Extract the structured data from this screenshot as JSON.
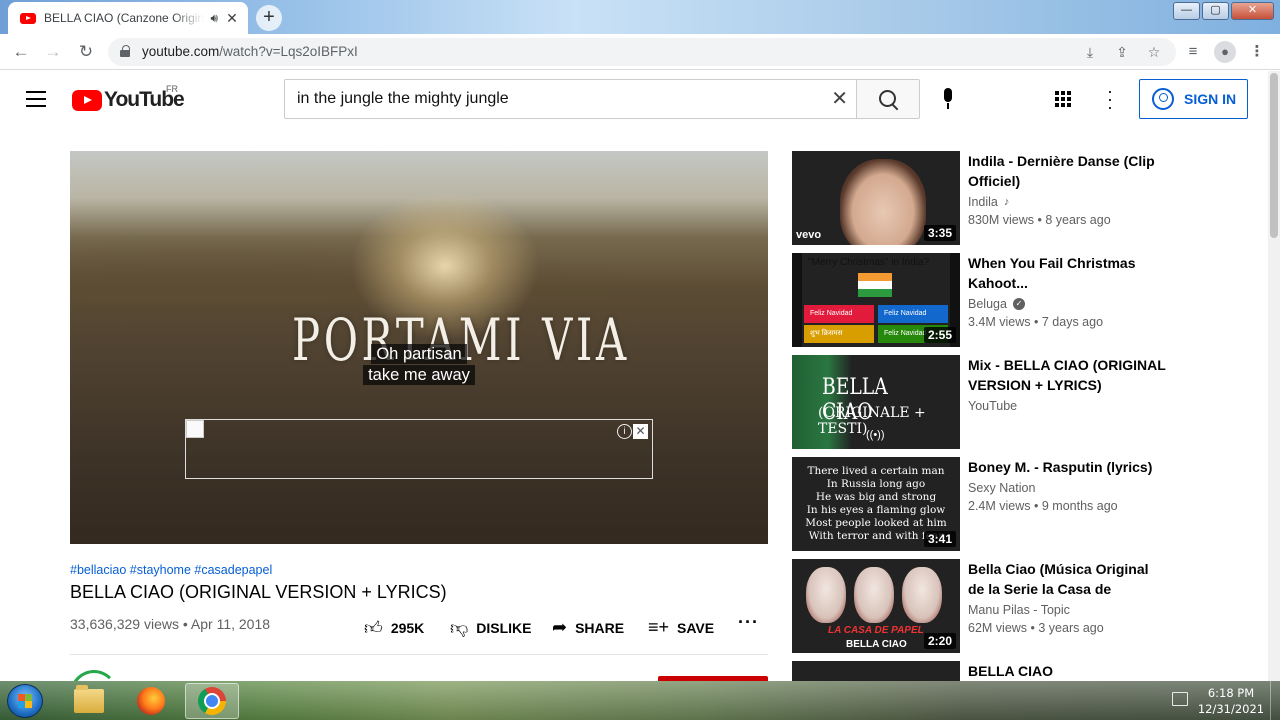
{
  "browser": {
    "tab_title": "BELLA CIAO (Canzone Originale + Testi)",
    "new_tab": "+",
    "url_host": "youtube.com",
    "url_path": "/watch?v=Lqs2oIBFPxI",
    "window_buttons": {
      "minimize": "—",
      "maximize": "▢",
      "close": "✕"
    }
  },
  "youtube": {
    "logo_text": "YouTube",
    "region": "FR",
    "search_value": "in the jungle the mighty jungle",
    "signin_label": "SIGN IN"
  },
  "player": {
    "burned_lyric": "PORTAMI VIA",
    "caption_line1": "Oh partisan",
    "caption_line2": "take me away"
  },
  "video": {
    "hashtags": "#bellaciao #stayhome #casadepapel",
    "title": "BELLA CIAO (ORIGINAL VERSION + LYRICS)",
    "views": "33,636,329 views",
    "date": "Apr 11, 2018",
    "likes": "295K",
    "dislike_label": "DISLIKE",
    "share_label": "SHARE",
    "save_label": "SAVE"
  },
  "related": [
    {
      "title": "Indila - Dernière Danse (Clip Officiel)",
      "channel": "Indila",
      "views": "830M views",
      "age": "8 years ago",
      "duration": "3:35",
      "thumb_text": "vevo"
    },
    {
      "title": "When You Fail Christmas Kahoot...",
      "channel": "Beluga",
      "views": "3.4M views",
      "age": "7 days ago",
      "duration": "2:55",
      "thumb_text": "\"Merry Christmas\" in India?",
      "options": [
        "Feliz Navidad",
        "Feliz Navidad",
        "शुभ क्रिसमस",
        "Feliz Navidad"
      ]
    },
    {
      "title": "Mix - BELLA CIAO (ORIGINAL VERSION + LYRICS)",
      "channel": "YouTube",
      "thumb_text1": "BELLA CIAO",
      "thumb_text2": "(ORIGINALE + TESTI)",
      "thumb_text3": "((•))"
    },
    {
      "title": "Boney M. - Rasputin (lyrics)",
      "channel": "Sexy Nation",
      "views": "2.4M views",
      "age": "9 months ago",
      "duration": "3:41",
      "thumb_lines": [
        "There lived a certain man",
        "In Russia long ago",
        "He was big and strong",
        "In his eyes a flaming glow",
        "Most people looked at him",
        "With terror and with fear"
      ]
    },
    {
      "title": "Bella Ciao (Música Original de la Serie la Casa de Papel/...",
      "channel": "Manu Pilas - Topic",
      "views": "62M views",
      "age": "3 years ago",
      "duration": "2:20",
      "thumb_text1": "LA CASA DE PAPEL",
      "thumb_text2": "BELLA CIAO"
    },
    {
      "title": "BELLA CIAO"
    }
  ],
  "taskbar": {
    "time": "6:18 PM",
    "date": "12/31/2021"
  }
}
